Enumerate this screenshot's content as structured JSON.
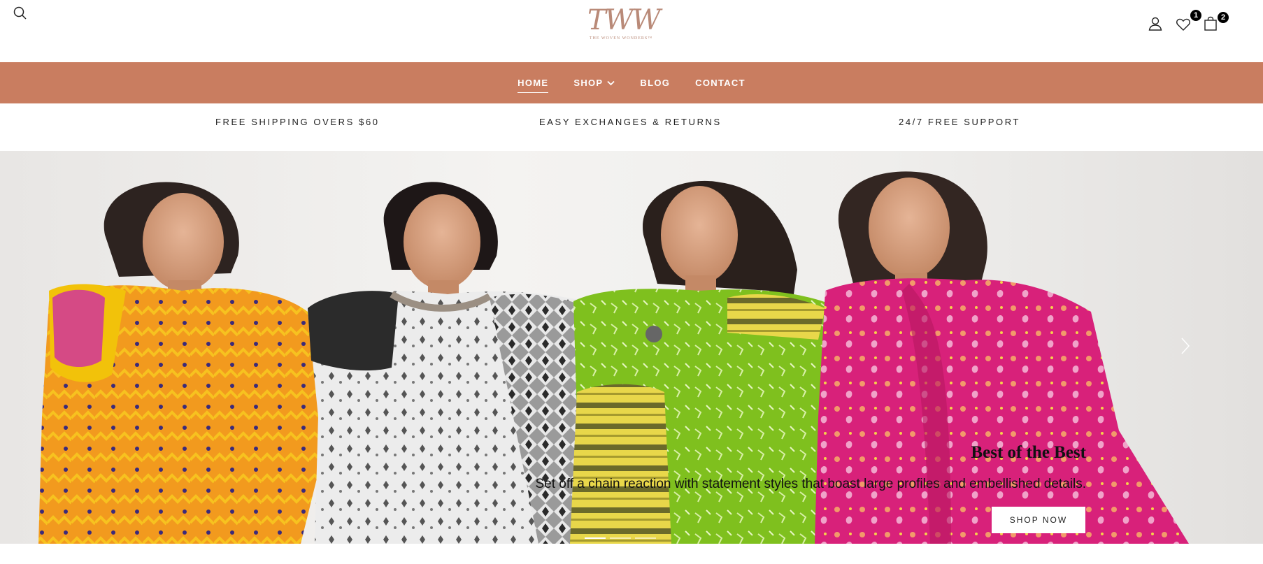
{
  "header": {
    "logo_mark": "TWW",
    "logo_tagline": "THE WOVEN WONDERS™",
    "wishlist_count": "1",
    "cart_count": "2"
  },
  "nav": {
    "items": [
      {
        "label": "HOME"
      },
      {
        "label": "SHOP"
      },
      {
        "label": "BLOG"
      },
      {
        "label": "CONTACT"
      }
    ]
  },
  "features": [
    {
      "label": "FREE SHIPPING OVERS $60"
    },
    {
      "label": "EASY EXCHANGES & RETURNS"
    },
    {
      "label": "24/7 FREE SUPPORT"
    }
  ],
  "hero": {
    "title": "Best of the Best",
    "description": "Set off a chain reaction with statement styles that boast large profiles and embellished details.",
    "button_label": "SHOP NOW",
    "slides_count": 3,
    "active_slide": 1
  },
  "colors": {
    "nav_bg": "#c97d60",
    "logo": "#b98a78",
    "saree_orange": "#f29a1e",
    "saree_white": "#e9e9e9",
    "saree_green": "#7fc01e",
    "saree_pink": "#d8217a"
  },
  "icons": [
    "search-icon",
    "user-icon",
    "heart-icon",
    "bag-icon",
    "chevron-down-icon",
    "chevron-right-icon"
  ]
}
